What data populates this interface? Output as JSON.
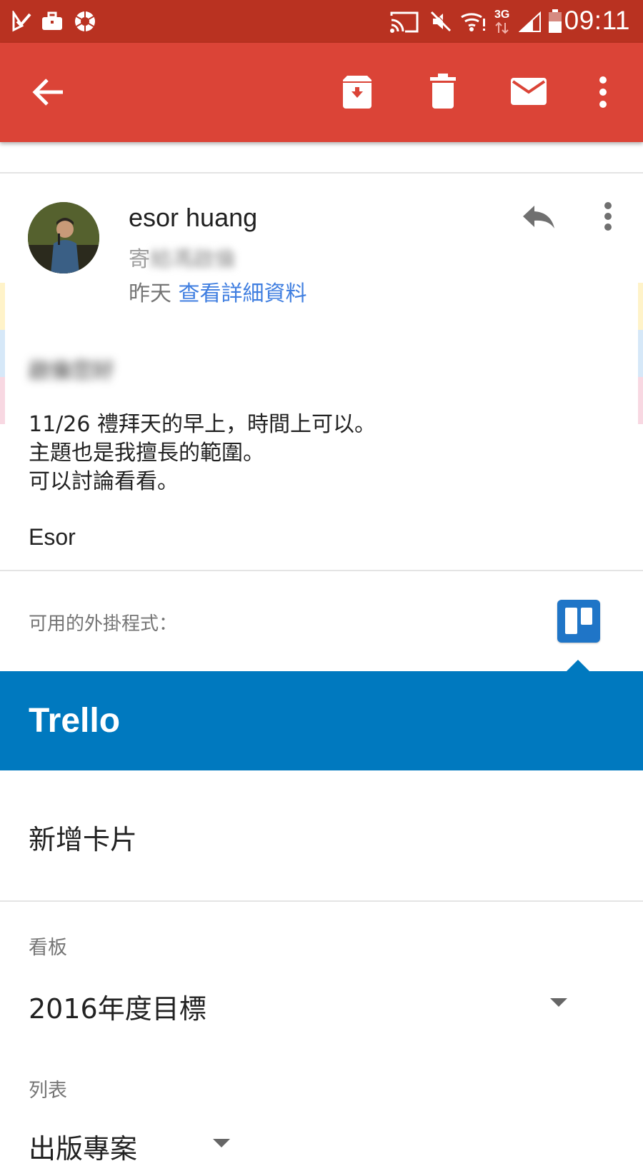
{
  "status_bar": {
    "time": "09:11",
    "network": "3G",
    "icons": [
      "task-icon",
      "briefcase-icon",
      "camera-shutter-icon",
      "cast-icon",
      "mute-icon",
      "wifi-icon",
      "signal-icon",
      "battery-icon"
    ]
  },
  "toolbar": {
    "icons": [
      "back-arrow-icon",
      "archive-icon",
      "delete-icon",
      "mark-unread-icon",
      "more-vert-icon"
    ]
  },
  "email": {
    "sender_name": "esor huang",
    "recipient_prefix": "寄",
    "recipient_rest": "給馮啟倫",
    "date": "昨天",
    "details_link": "查看詳細資料",
    "greeting": "啟倫您好",
    "body": "11/26 禮拜天的早上，時間上可以。\n主題也是我擅長的範圍。\n可以討論看看。",
    "signature": "Esor"
  },
  "addons": {
    "label": "可用的外掛程式："
  },
  "trello": {
    "title": "Trello",
    "add_card": "新增卡片",
    "board_label": "看板",
    "board_value": "2016年度目標",
    "list_label": "列表",
    "list_value": "出版專案"
  },
  "colors": {
    "status_bar": "#b93221",
    "app_bar": "#db4437",
    "link": "#3f7ee0",
    "trello": "#0079bf"
  }
}
